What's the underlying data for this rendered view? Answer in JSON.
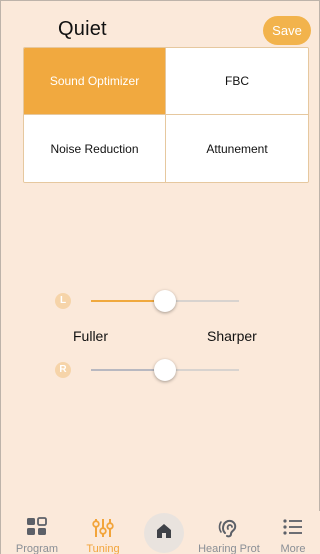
{
  "header": {
    "title": "Quiet",
    "save_label": "Save"
  },
  "modes": [
    {
      "label": "Sound Optimizer",
      "active": true
    },
    {
      "label": "FBC",
      "active": false
    },
    {
      "label": "Noise Reduction",
      "active": false
    },
    {
      "label": "Attunement",
      "active": false
    }
  ],
  "tone": {
    "left_channel": "L",
    "right_channel": "R",
    "left_value": 0.5,
    "right_value": 0.5,
    "label_low": "Fuller",
    "label_high": "Sharper"
  },
  "tabbar": [
    {
      "label": "Program",
      "icon": "grid-icon",
      "active": false
    },
    {
      "label": "Tuning",
      "icon": "sliders-icon",
      "active": true
    },
    {
      "label": "",
      "icon": "home-icon",
      "active": false
    },
    {
      "label": "Hearing Prot",
      "icon": "ear-icon",
      "active": false
    },
    {
      "label": "More",
      "icon": "list-icon",
      "active": false
    }
  ],
  "colors": {
    "accent": "#f1a93f",
    "background": "#fbe9da",
    "save_button": "#f2b34c"
  }
}
